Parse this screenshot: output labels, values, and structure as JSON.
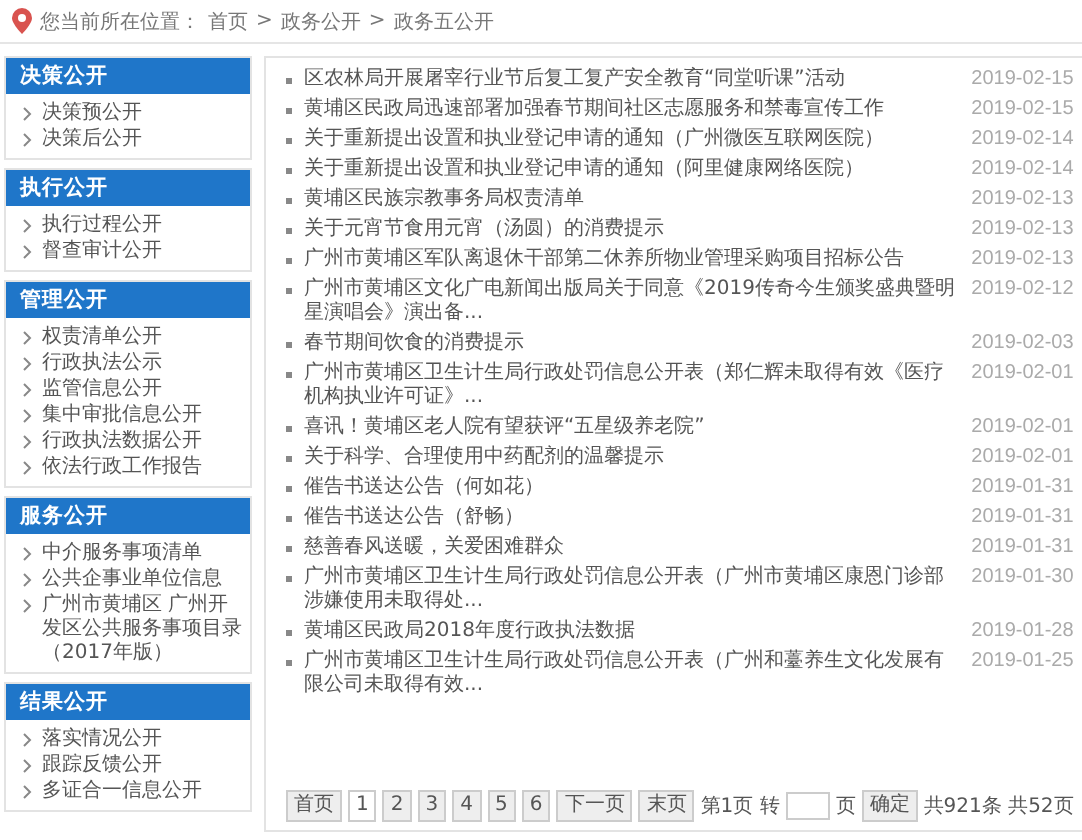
{
  "breadcrumb": {
    "label": "您当前所在位置：",
    "crumbs": [
      "首页",
      "政务公开",
      "政务五公开"
    ],
    "separators": [
      ">",
      ">"
    ]
  },
  "sidebar": [
    {
      "title": "决策公开",
      "items": [
        "决策预公开",
        "决策后公开"
      ]
    },
    {
      "title": "执行公开",
      "items": [
        "执行过程公开",
        "督查审计公开"
      ]
    },
    {
      "title": "管理公开",
      "items": [
        "权责清单公开",
        "行政执法公示",
        "监管信息公开",
        "集中审批信息公开",
        "行政执法数据公开",
        "依法行政工作报告"
      ]
    },
    {
      "title": "服务公开",
      "items": [
        "中介服务事项清单",
        "公共企事业单位信息",
        "广州市黄埔区 广州开发区公共服务事项目录（2017年版）"
      ]
    },
    {
      "title": "结果公开",
      "items": [
        "落实情况公开",
        "跟踪反馈公开",
        "多证合一信息公开"
      ]
    }
  ],
  "articles": [
    {
      "title": "区农林局开展屠宰行业节后复工复产安全教育“同堂听课”活动",
      "date": "2019-02-15"
    },
    {
      "title": "黄埔区民政局迅速部署加强春节期间社区志愿服务和禁毒宣传工作",
      "date": "2019-02-15"
    },
    {
      "title": "关于重新提出设置和执业登记申请的通知（广州微医互联网医院）",
      "date": "2019-02-14"
    },
    {
      "title": "关于重新提出设置和执业登记申请的通知（阿里健康网络医院）",
      "date": "2019-02-14"
    },
    {
      "title": "黄埔区民族宗教事务局权责清单",
      "date": "2019-02-13"
    },
    {
      "title": "关于元宵节食用元宵（汤圆）的消费提示",
      "date": "2019-02-13"
    },
    {
      "title": "广州市黄埔区军队离退休干部第二休养所物业管理采购项目招标公告",
      "date": "2019-02-13"
    },
    {
      "title": "广州市黄埔区文化广电新闻出版局关于同意《2019传奇今生颁奖盛典暨明星演唱会》演出备...",
      "date": "2019-02-12"
    },
    {
      "title": "春节期间饮食的消费提示",
      "date": "2019-02-03"
    },
    {
      "title": "广州市黄埔区卫生计生局行政处罚信息公开表（郑仁辉未取得有效《医疗机构执业许可证》...",
      "date": "2019-02-01"
    },
    {
      "title": "喜讯！黄埔区老人院有望获评“五星级养老院”",
      "date": "2019-02-01"
    },
    {
      "title": "关于科学、合理使用中药配剂的温馨提示",
      "date": "2019-02-01"
    },
    {
      "title": "催告书送达公告（何如花）",
      "date": "2019-01-31"
    },
    {
      "title": "催告书送达公告（舒畅）",
      "date": "2019-01-31"
    },
    {
      "title": "慈善春风送暖，关爱困难群众",
      "date": "2019-01-31"
    },
    {
      "title": "广州市黄埔区卫生计生局行政处罚信息公开表（广州市黄埔区康恩门诊部涉嫌使用未取得处...",
      "date": "2019-01-30"
    },
    {
      "title": "黄埔区民政局2018年度行政执法数据",
      "date": "2019-01-28"
    },
    {
      "title": "广州市黄埔区卫生计生局行政处罚信息公开表（广州和薹养生文化发展有限公司未取得有效...",
      "date": "2019-01-25"
    }
  ],
  "pagination": {
    "first": "首页",
    "pages": [
      {
        "label": "1",
        "selected": true
      },
      {
        "label": "2",
        "selected": false
      },
      {
        "label": "3",
        "selected": false
      },
      {
        "label": "4",
        "selected": false
      },
      {
        "label": "5",
        "selected": false
      },
      {
        "label": "6",
        "selected": false
      }
    ],
    "next": "下一页",
    "last": "末页",
    "current": "第1页 转",
    "page_unit": "页",
    "confirm": "确定",
    "total": "共921条 共52页"
  }
}
